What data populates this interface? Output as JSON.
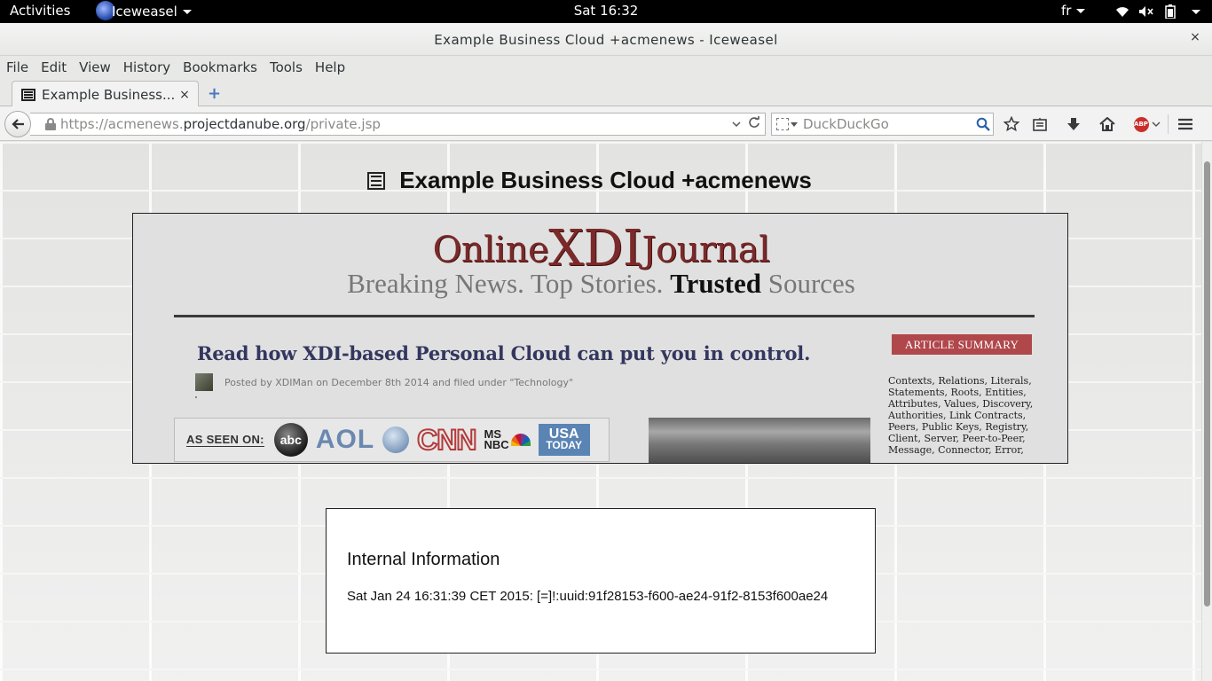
{
  "topbar": {
    "activities": "Activities",
    "app_name": "Iceweasel",
    "clock": "Sat 16:32",
    "lang": "fr"
  },
  "window": {
    "title": "Example Business Cloud +acmenews - Iceweasel",
    "close_glyph": "×"
  },
  "menubar": {
    "items": [
      "File",
      "Edit",
      "View",
      "History",
      "Bookmarks",
      "Tools",
      "Help"
    ]
  },
  "tabs": {
    "active_title": "Example Business...",
    "close_glyph": "×",
    "new_tab_glyph": "+"
  },
  "navbar": {
    "url_scheme": "https://acmenews.",
    "url_domain": "projectdanube.org",
    "url_path": "/private.jsp",
    "search_placeholder": "DuckDuckGo"
  },
  "page": {
    "heading": "Example Business Cloud +acmenews",
    "journal": {
      "title_left": "Online",
      "title_mid": "XDI",
      "title_right": "Journal",
      "tagline_start": "Breaking News. Top Stories. ",
      "tagline_bold": "Trusted",
      "tagline_end": " Sources",
      "headline": "Read how XDI-based Personal Cloud can put you in control.",
      "byline": "Posted by XDIMan on December 8th 2014 and filed under \"Technology\"",
      "as_seen_on": "AS SEEN ON:",
      "logos": {
        "abc": "abc",
        "aol": "AOL",
        "cnn": "CNN",
        "msnbc_top": "MS",
        "msnbc_bottom": "NBC",
        "usa_top": "USA",
        "usa_bottom": "TODAY"
      },
      "summary_label": "ARTICLE SUMMARY",
      "summary_text": "Contexts, Relations, Literals, Statements, Roots, Entities, Attributes, Values, Discovery, Authorities, Link Contracts, Peers, Public Keys, Registry, Client, Server, Peer-to-Peer, Message, Connector, Error,"
    },
    "info": {
      "title": "Internal Information",
      "text": "Sat Jan 24 16:31:39 CET 2015: [=]!:uuid:91f28153-f600-ae24-91f2-8153f600ae24"
    }
  },
  "icons": [
    "globe-icon",
    "wifi-icon",
    "volume-muted-icon",
    "battery-icon",
    "power-menu-caret-icon",
    "back-arrow-icon",
    "lock-icon",
    "dropdown-icon",
    "reload-icon",
    "search-engine-icon",
    "magnifier-icon",
    "bookmark-star-icon",
    "reading-list-icon",
    "download-icon",
    "home-icon",
    "adblock-icon",
    "hamburger-menu-icon"
  ]
}
